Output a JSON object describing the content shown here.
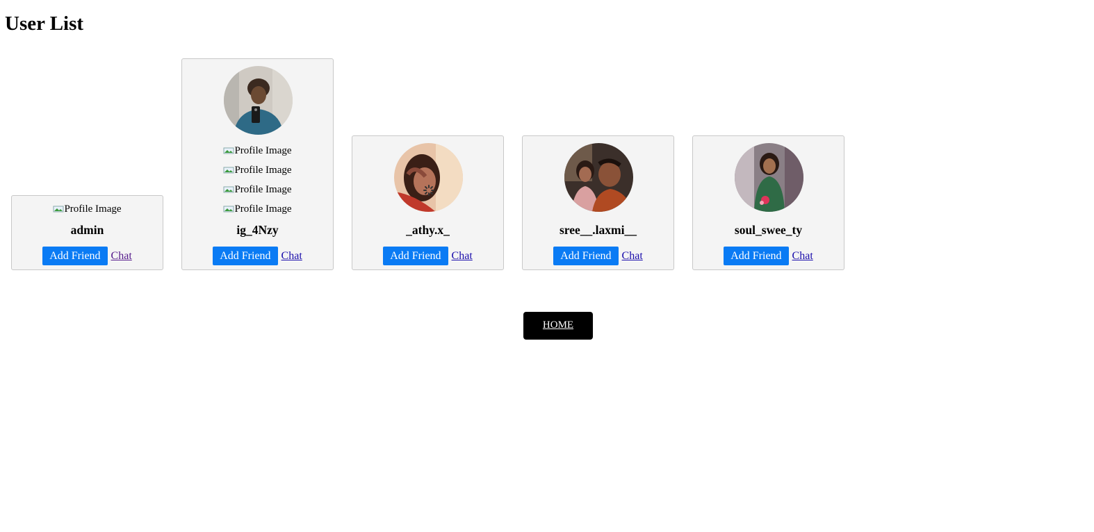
{
  "page": {
    "title": "User List"
  },
  "users": [
    {
      "username": "admin",
      "broken_images": [
        "Profile Image"
      ],
      "add_friend_label": "Add Friend",
      "chat_label": "Chat",
      "avatar": "none"
    },
    {
      "username": "ig_4Nzy",
      "broken_images": [
        "Profile Image",
        "Profile Image",
        "Profile Image",
        "Profile Image"
      ],
      "add_friend_label": "Add Friend",
      "chat_label": "Chat",
      "avatar": "young-man-mirror-selfie"
    },
    {
      "username": "_athy.x_",
      "broken_images": [],
      "add_friend_label": "Add Friend",
      "chat_label": "Chat",
      "avatar": "woman-selfie-loading"
    },
    {
      "username": "sree__.laxmi__",
      "broken_images": [],
      "add_friend_label": "Add Friend",
      "chat_label": "Chat",
      "avatar": "couple-selfie"
    },
    {
      "username": "soul_swee_ty",
      "broken_images": [],
      "add_friend_label": "Add Friend",
      "chat_label": "Chat",
      "avatar": "girl-green-dress"
    }
  ],
  "footer": {
    "home_label": "HOME"
  },
  "colors": {
    "button": "#0a7bf4",
    "card_bg": "#f4f4f4",
    "home_bg": "#000000"
  }
}
